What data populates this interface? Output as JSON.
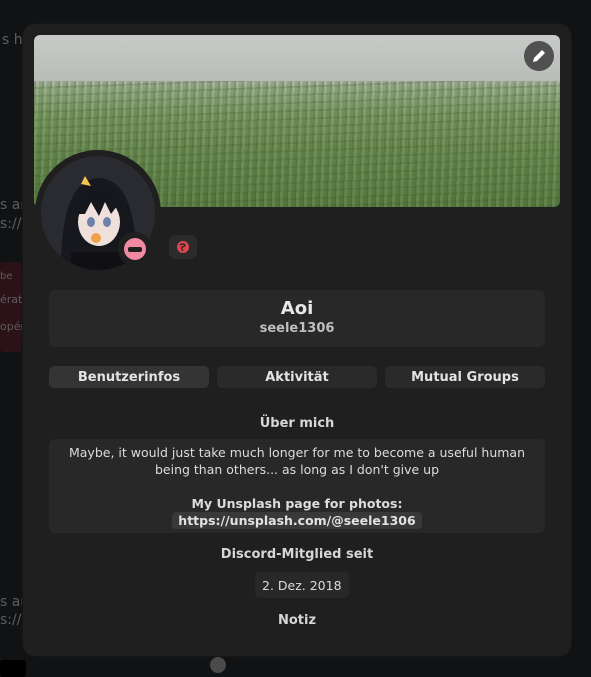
{
  "profile": {
    "display_name": "Aoi",
    "username": "seele1306",
    "status": "Bitte nicht stören"
  },
  "tabs": [
    {
      "label": "Benutzerinfos",
      "active": true
    },
    {
      "label": "Aktivität",
      "active": false
    },
    {
      "label": "Mutual Groups",
      "active": false
    }
  ],
  "about": {
    "title": "Über mich",
    "bio": "Maybe, it would just take much longer for me to become a useful human being than others... as long as I don't give up",
    "link_label": "My Unsplash page for photos:",
    "link": "https://unsplash.com/@seele1306"
  },
  "member_since": {
    "title": "Discord-Mitglied seit",
    "date": "2. Dez. 2018"
  },
  "note": {
    "title": "Notiz"
  },
  "background": {
    "fragments": [
      "s ho",
      "s an",
      "s://y",
      "be",
      "érat",
      "opér",
      "s an",
      "s://c"
    ]
  },
  "icons": {
    "edit": "pencil-icon",
    "status": "do-not-disturb-icon",
    "badge": "globe-icon",
    "background_app": "spotify-icon"
  },
  "colors": {
    "modal_bg": "#1f1f1f",
    "card_bg": "#282828",
    "status_dnd": "#f18aa0",
    "badge_globe": "#e0454f"
  }
}
